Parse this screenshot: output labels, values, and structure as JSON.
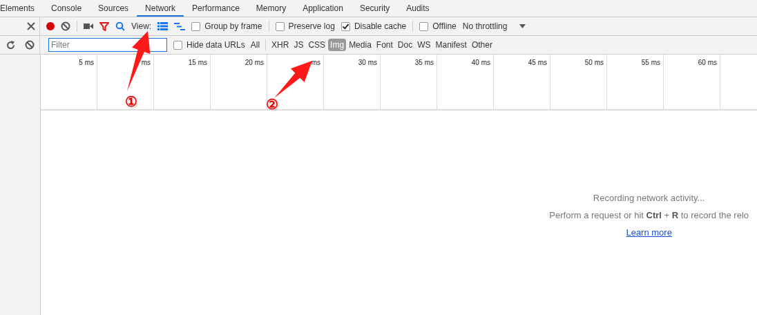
{
  "tabs": [
    {
      "label": "Elements",
      "selected": false
    },
    {
      "label": "Console",
      "selected": false
    },
    {
      "label": "Sources",
      "selected": false
    },
    {
      "label": "Network",
      "selected": true
    },
    {
      "label": "Performance",
      "selected": false
    },
    {
      "label": "Memory",
      "selected": false
    },
    {
      "label": "Application",
      "selected": false
    },
    {
      "label": "Security",
      "selected": false
    },
    {
      "label": "Audits",
      "selected": false
    }
  ],
  "toolbar": {
    "recording": true,
    "view_label": "View:",
    "group_by_frame": {
      "label": "Group by frame",
      "checked": false
    },
    "preserve_log": {
      "label": "Preserve log",
      "checked": false
    },
    "disable_cache": {
      "label": "Disable cache",
      "checked": true
    },
    "offline": {
      "label": "Offline",
      "checked": false
    },
    "throttling": "No throttling"
  },
  "filter_bar": {
    "placeholder": "Filter",
    "hide_data_urls": {
      "label": "Hide data URLs",
      "checked": false
    },
    "all": "All",
    "types": [
      {
        "label": "XHR",
        "selected": false
      },
      {
        "label": "JS",
        "selected": false
      },
      {
        "label": "CSS",
        "selected": false
      },
      {
        "label": "Img",
        "selected": true
      },
      {
        "label": "Media",
        "selected": false
      },
      {
        "label": "Font",
        "selected": false
      },
      {
        "label": "Doc",
        "selected": false
      },
      {
        "label": "WS",
        "selected": false
      },
      {
        "label": "Manifest",
        "selected": false
      },
      {
        "label": "Other",
        "selected": false
      }
    ]
  },
  "timeline": {
    "ticks": [
      "5 ms",
      "ms",
      "15 ms",
      "20 ms",
      "ms",
      "30 ms",
      "35 ms",
      "40 ms",
      "45 ms",
      "50 ms",
      "55 ms",
      "60 ms"
    ]
  },
  "message": {
    "title": "Recording network activity...",
    "hint": "Perform a request or hit **Ctrl** + **R** to record the relo",
    "link": "Learn more"
  },
  "annotations": [
    {
      "label": "①"
    },
    {
      "label": "②"
    }
  ]
}
